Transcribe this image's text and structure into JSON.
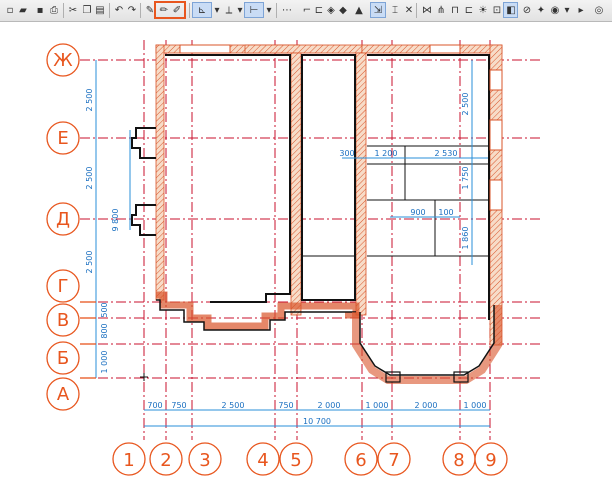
{
  "toolbar": {
    "icons": [
      "new-file-icon",
      "open-folder-icon",
      "save-icon",
      "print-icon",
      "cut-icon",
      "copy-icon",
      "paste-icon",
      "undo-icon",
      "redo-icon",
      "pipette-icon",
      "pencil-icon",
      "pencil-active-icon",
      "snap-icon",
      "guide-icon",
      "select-arrow-icon",
      "wall-icon",
      "door-icon",
      "window-icon",
      "fill-icon",
      "pen-icon",
      "layers-icon",
      "arrow-icon",
      "close-icon",
      "section-icon",
      "elevation-icon",
      "detail-icon",
      "zone-icon",
      "label-icon",
      "color-icon",
      "navigator-icon"
    ]
  },
  "drawing": {
    "row_axes": [
      "Ж",
      "Е",
      "Д",
      "Г",
      "В",
      "Б",
      "А"
    ],
    "col_axes": [
      "1",
      "2",
      "3",
      "4",
      "5",
      "6",
      "7",
      "8",
      "9"
    ],
    "bottom_dims": [
      "700",
      "750",
      "2 500",
      "750",
      "2 000",
      "1 000",
      "2 000",
      "1 000"
    ],
    "total_width": "10 700",
    "left_dims": [
      "2 500",
      "2 500",
      "2 500",
      "500",
      "800",
      "1 000"
    ],
    "total_height": "9 800",
    "interior_dims": [
      "300",
      "1 200",
      "2 530",
      "900",
      "100"
    ],
    "right_dims": [
      "2 500",
      "1 750",
      "1 860"
    ]
  }
}
